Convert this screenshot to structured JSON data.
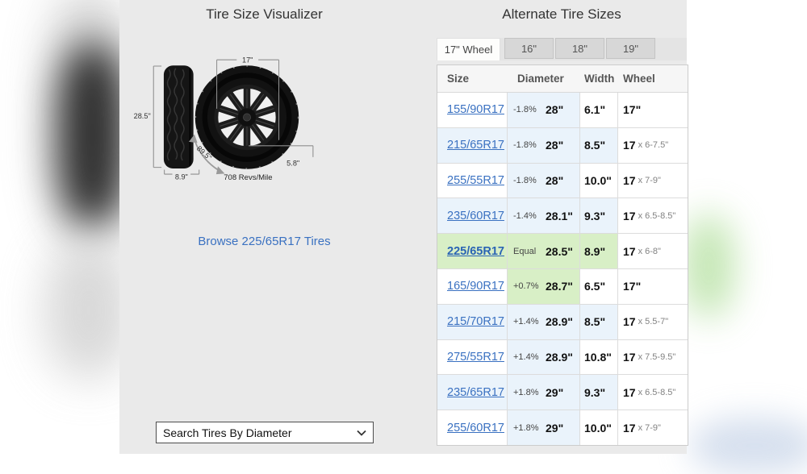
{
  "left_panel": {
    "title": "Tire Size Visualizer",
    "labels": {
      "height": "28.5\"",
      "width": "8.9\"",
      "rim_diameter": "17\"",
      "circumference": "89.5\"",
      "sidewall": "5.8\"",
      "revs": "708 Revs/Mile"
    },
    "browse_link": "Browse 225/65R17 Tires",
    "dropdown_value": "Search Tires By Diameter"
  },
  "right_panel": {
    "title": "Alternate Tire Sizes",
    "tabs": [
      {
        "label": "17\" Wheel",
        "active": true
      },
      {
        "label": "16\"",
        "active": false
      },
      {
        "label": "18\"",
        "active": false
      },
      {
        "label": "19\"",
        "active": false
      }
    ],
    "columns": [
      "Size",
      "Diameter",
      "Width",
      "Wheel"
    ],
    "rows": [
      {
        "size": "155/90R17",
        "diff": "-1.8%",
        "diameter": "28\"",
        "width": "6.1\"",
        "wheel": "17\"",
        "wheel_range": "",
        "row_bg": "white",
        "dia_bg": "blue",
        "selected": false
      },
      {
        "size": "215/65R17",
        "diff": "-1.8%",
        "diameter": "28\"",
        "width": "8.5\"",
        "wheel": "17",
        "wheel_range": "x 6-7.5\"",
        "row_bg": "blue",
        "dia_bg": "blue",
        "selected": false
      },
      {
        "size": "255/55R17",
        "diff": "-1.8%",
        "diameter": "28\"",
        "width": "10.0\"",
        "wheel": "17",
        "wheel_range": "x 7-9\"",
        "row_bg": "white",
        "dia_bg": "blue",
        "selected": false
      },
      {
        "size": "235/60R17",
        "diff": "-1.4%",
        "diameter": "28.1\"",
        "width": "9.3\"",
        "wheel": "17",
        "wheel_range": "x 6.5-8.5\"",
        "row_bg": "blue",
        "dia_bg": "blue",
        "selected": false
      },
      {
        "size": "225/65R17",
        "diff": "Equal",
        "diameter": "28.5\"",
        "width": "8.9\"",
        "wheel": "17",
        "wheel_range": "x 6-8\"",
        "row_bg": "green",
        "dia_bg": "green",
        "selected": true
      },
      {
        "size": "165/90R17",
        "diff": "+0.7%",
        "diameter": "28.7\"",
        "width": "6.5\"",
        "wheel": "17\"",
        "wheel_range": "",
        "row_bg": "white",
        "dia_bg": "green",
        "selected": false
      },
      {
        "size": "215/70R17",
        "diff": "+1.4%",
        "diameter": "28.9\"",
        "width": "8.5\"",
        "wheel": "17",
        "wheel_range": "x 5.5-7\"",
        "row_bg": "blue",
        "dia_bg": "blue",
        "selected": false
      },
      {
        "size": "275/55R17",
        "diff": "+1.4%",
        "diameter": "28.9\"",
        "width": "10.8\"",
        "wheel": "17",
        "wheel_range": "x 7.5-9.5\"",
        "row_bg": "white",
        "dia_bg": "blue",
        "selected": false
      },
      {
        "size": "235/65R17",
        "diff": "+1.8%",
        "diameter": "29\"",
        "width": "9.3\"",
        "wheel": "17",
        "wheel_range": "x 6.5-8.5\"",
        "row_bg": "blue",
        "dia_bg": "blue",
        "selected": false
      },
      {
        "size": "255/60R17",
        "diff": "+1.8%",
        "diameter": "29\"",
        "width": "10.0\"",
        "wheel": "17",
        "wheel_range": "x 7-9\"",
        "row_bg": "white",
        "dia_bg": "blue",
        "selected": false
      }
    ]
  },
  "colors": {
    "link-blue": "#3a71c1",
    "selected-link-blue": "#2a64b4",
    "row-highlight-green": "#d8efc6",
    "row-stripe-blue": "#eaf3fb",
    "panel-gray": "#eaeaea",
    "tab-inactive-gray": "#d7d7d7",
    "tab-band-gray": "#e4e4e4"
  }
}
